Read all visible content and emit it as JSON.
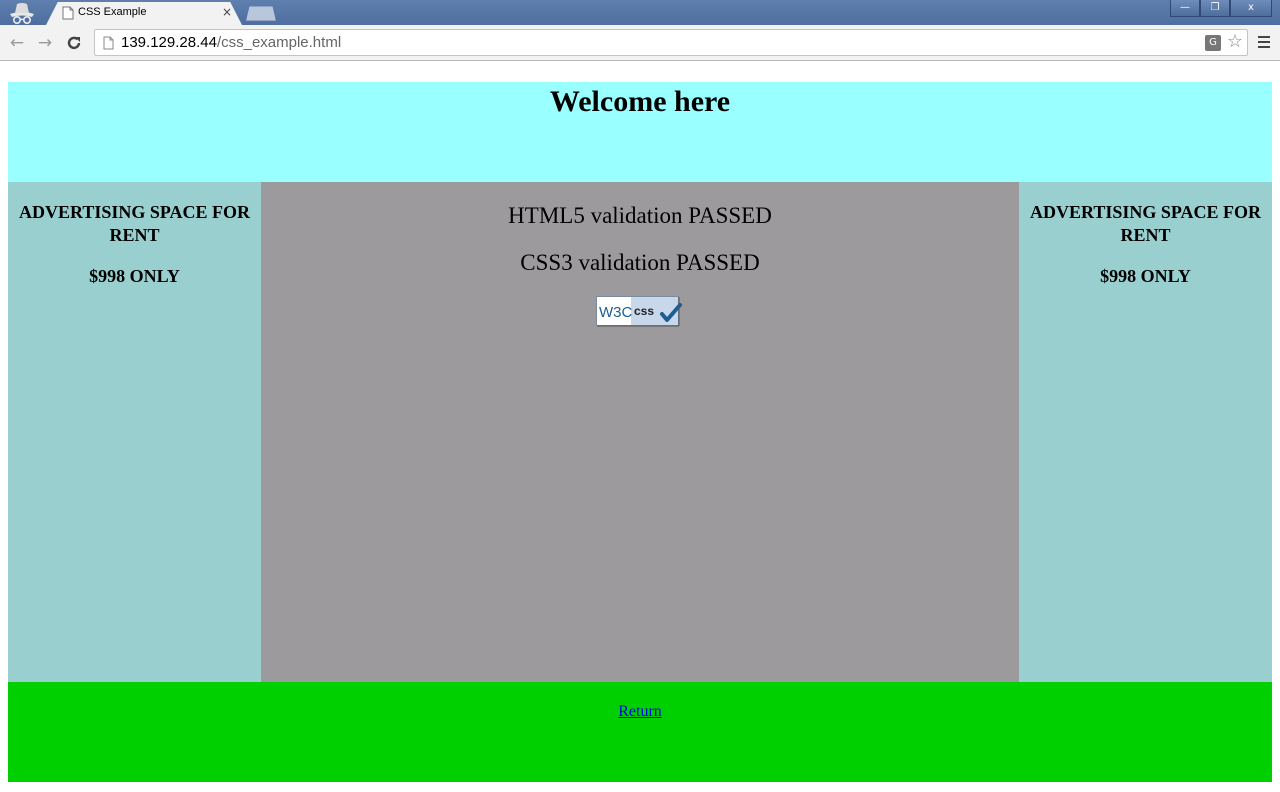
{
  "browser": {
    "tab_title": "CSS Example",
    "tab_close": "×",
    "url_host": "139.129.28.44",
    "url_path": "/css_example.html",
    "window_controls": {
      "minimize": "—",
      "restore": "❐",
      "close": "x"
    },
    "icons": [
      "incognito-icon",
      "page-icon",
      "back-icon",
      "forward-icon",
      "reload-icon",
      "translate-icon",
      "star-icon",
      "menu-icon"
    ]
  },
  "page": {
    "header": {
      "title": "Welcome here",
      "color": "#99ffff"
    },
    "left_ad": {
      "title": "ADVERTISING SPACE FOR RENT",
      "price": "$998 ONLY",
      "color": "#99cfcf"
    },
    "right_ad": {
      "title": "ADVERTISING SPACE FOR RENT",
      "price": "$998 ONLY",
      "color": "#99cfcf"
    },
    "main": {
      "line1": "HTML5 validation PASSED",
      "line2": "CSS3 validation PASSED",
      "badge": {
        "w3c": "W3C",
        "label": "css"
      },
      "color": "#9c9a9c"
    },
    "footer": {
      "link": "Return",
      "color": "#00cf00"
    }
  }
}
